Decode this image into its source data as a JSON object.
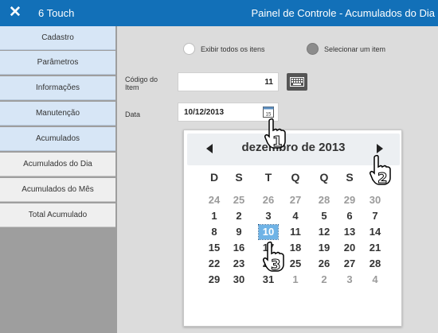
{
  "header": {
    "app_title": "6 Touch",
    "panel_title": "Painel de Controle - Acumulados do Dia",
    "close_icon": "close-icon"
  },
  "sidebar": {
    "items": [
      {
        "label": "Cadastro"
      },
      {
        "label": "Parâmetros"
      },
      {
        "label": "Informações"
      },
      {
        "label": "Manutenção"
      },
      {
        "label": "Acumulados"
      },
      {
        "label": "Acumulados do Dia"
      },
      {
        "label": "Acumulados do Mês"
      },
      {
        "label": "Total Acumulado"
      }
    ]
  },
  "form": {
    "radio_all": "Exibir todos os itens",
    "radio_select": "Selecionar um item",
    "code_label_1": "Código do",
    "code_label_2": "Item",
    "code_value": "11",
    "date_label": "Data",
    "date_value": "10/12/2013"
  },
  "calendar": {
    "month_label": "dezembro de 2013",
    "weekdays": [
      "D",
      "S",
      "T",
      "Q",
      "Q",
      "S",
      "S"
    ],
    "weeks": [
      [
        "24",
        "25",
        "26",
        "27",
        "28",
        "29",
        "30"
      ],
      [
        "1",
        "2",
        "3",
        "4",
        "5",
        "6",
        "7"
      ],
      [
        "8",
        "9",
        "10",
        "11",
        "12",
        "13",
        "14"
      ],
      [
        "15",
        "16",
        "17",
        "18",
        "19",
        "20",
        "21"
      ],
      [
        "22",
        "23",
        "24",
        "25",
        "26",
        "27",
        "28"
      ],
      [
        "29",
        "30",
        "31",
        "1",
        "2",
        "3",
        "4"
      ]
    ],
    "selected": "10"
  },
  "annotations": {
    "step1": "1",
    "step2": "2",
    "step3": "3"
  },
  "colors": {
    "topbar": "#1270b8",
    "selected_day": "#6fb3e6",
    "sidebar_main": "#d7e6f6"
  }
}
